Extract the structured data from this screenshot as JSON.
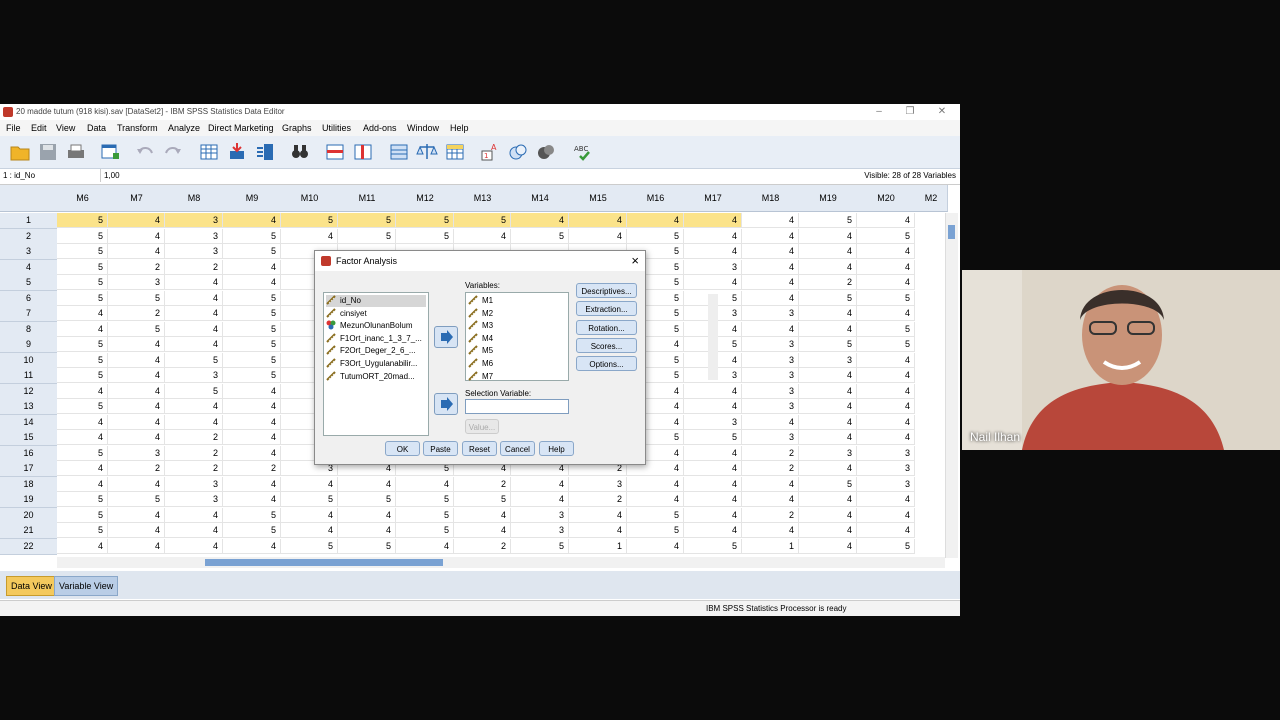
{
  "window": {
    "title": "20 madde tutum (918 kisi).sav [DataSet2] - IBM SPSS Statistics Data Editor"
  },
  "menu": [
    "File",
    "Edit",
    "View",
    "Data",
    "Transform",
    "Analyze",
    "Direct Marketing",
    "Graphs",
    "Utilities",
    "Add-ons",
    "Window",
    "Help"
  ],
  "toolbar": {
    "icons": [
      "open-icon",
      "save-icon",
      "print-icon",
      "dialog-recall-icon",
      "undo-icon",
      "redo-icon",
      "goto-case-icon",
      "goto-variable-icon",
      "variables-icon",
      "find-icon",
      "insert-cases-icon",
      "insert-variable-icon",
      "split-file-icon",
      "weight-cases-icon",
      "select-cases-icon",
      "value-labels-icon",
      "use-sets-icon",
      "show-sets-icon",
      "spell-check-icon"
    ]
  },
  "cellbar": {
    "ref": "1 : id_No",
    "value": "1,00",
    "visible": "Visible: 28 of 28 Variables"
  },
  "grid": {
    "columns": [
      "M6",
      "M7",
      "M8",
      "M9",
      "M10",
      "M11",
      "M12",
      "M13",
      "M14",
      "M15",
      "M16",
      "M17",
      "M18",
      "M19",
      "M20",
      "M2"
    ],
    "rows": [
      [
        "1",
        "5",
        "4",
        "3",
        "4",
        "5",
        "5",
        "5",
        "5",
        "4",
        "4",
        "4",
        "4",
        "4",
        "5",
        "4"
      ],
      [
        "2",
        "5",
        "4",
        "3",
        "5",
        "4",
        "5",
        "5",
        "4",
        "5",
        "4",
        "5",
        "4",
        "4",
        "4",
        "5"
      ],
      [
        "3",
        "5",
        "4",
        "3",
        "5",
        "",
        "",
        "",
        "",
        "",
        "",
        "5",
        "4",
        "4",
        "4",
        "4"
      ],
      [
        "4",
        "5",
        "2",
        "2",
        "4",
        "",
        "",
        "",
        "",
        "",
        "",
        "5",
        "3",
        "4",
        "4",
        "4"
      ],
      [
        "5",
        "5",
        "3",
        "4",
        "4",
        "",
        "",
        "",
        "",
        "",
        "",
        "5",
        "4",
        "4",
        "2",
        "4"
      ],
      [
        "6",
        "5",
        "5",
        "4",
        "5",
        "",
        "",
        "",
        "",
        "",
        "",
        "5",
        "5",
        "4",
        "5",
        "5"
      ],
      [
        "7",
        "4",
        "2",
        "4",
        "5",
        "",
        "",
        "",
        "",
        "",
        "",
        "5",
        "3",
        "3",
        "4",
        "4"
      ],
      [
        "8",
        "4",
        "5",
        "4",
        "5",
        "",
        "",
        "",
        "",
        "",
        "",
        "5",
        "4",
        "4",
        "4",
        "5"
      ],
      [
        "9",
        "5",
        "4",
        "4",
        "5",
        "",
        "",
        "",
        "",
        "",
        "",
        "4",
        "5",
        "3",
        "5",
        "5"
      ],
      [
        "10",
        "5",
        "4",
        "5",
        "5",
        "",
        "",
        "",
        "",
        "",
        "",
        "5",
        "4",
        "3",
        "3",
        "4"
      ],
      [
        "11",
        "5",
        "4",
        "3",
        "5",
        "",
        "",
        "",
        "",
        "",
        "",
        "5",
        "3",
        "3",
        "4",
        "4"
      ],
      [
        "12",
        "4",
        "4",
        "5",
        "4",
        "",
        "",
        "",
        "",
        "",
        "",
        "4",
        "4",
        "3",
        "4",
        "4"
      ],
      [
        "13",
        "5",
        "4",
        "4",
        "4",
        "",
        "",
        "",
        "",
        "",
        "",
        "4",
        "4",
        "3",
        "4",
        "4"
      ],
      [
        "14",
        "4",
        "4",
        "4",
        "4",
        "",
        "",
        "",
        "",
        "",
        "",
        "4",
        "3",
        "4",
        "4",
        "4"
      ],
      [
        "15",
        "4",
        "4",
        "2",
        "4",
        "",
        "",
        "",
        "",
        "",
        "",
        "5",
        "5",
        "3",
        "4",
        "4"
      ],
      [
        "16",
        "5",
        "3",
        "2",
        "4",
        "",
        "",
        "",
        "",
        "",
        "",
        "4",
        "4",
        "2",
        "3",
        "3"
      ],
      [
        "17",
        "4",
        "2",
        "2",
        "2",
        "3",
        "4",
        "5",
        "4",
        "4",
        "2",
        "4",
        "4",
        "2",
        "4",
        "3"
      ],
      [
        "18",
        "4",
        "4",
        "3",
        "4",
        "4",
        "4",
        "4",
        "2",
        "4",
        "3",
        "4",
        "4",
        "4",
        "5",
        "3"
      ],
      [
        "19",
        "5",
        "5",
        "3",
        "4",
        "5",
        "5",
        "5",
        "5",
        "4",
        "2",
        "4",
        "4",
        "4",
        "4",
        "4"
      ],
      [
        "20",
        "5",
        "4",
        "4",
        "5",
        "4",
        "4",
        "5",
        "4",
        "3",
        "4",
        "5",
        "4",
        "2",
        "4",
        "4"
      ],
      [
        "21",
        "5",
        "4",
        "4",
        "5",
        "4",
        "4",
        "5",
        "4",
        "3",
        "4",
        "5",
        "4",
        "4",
        "4",
        "4"
      ],
      [
        "22",
        "4",
        "4",
        "4",
        "4",
        "5",
        "5",
        "4",
        "2",
        "5",
        "1",
        "4",
        "5",
        "1",
        "4",
        "5"
      ]
    ]
  },
  "tabs": {
    "data_view": "Data View",
    "variable_view": "Variable View"
  },
  "status": "IBM SPSS Statistics Processor is ready",
  "dialog": {
    "title": "Factor Analysis",
    "source_vars": [
      "id_No",
      "cinsiyet",
      "MezunOlunanBolum",
      "F1Ort_inanc_1_3_7_...",
      "F2Ort_Deger_2_6_...",
      "F3Ort_Uygulanabilir...",
      "TutumORT_20mad..."
    ],
    "variables_label": "Variables:",
    "variables": [
      "M1",
      "M2",
      "M3",
      "M4",
      "M5",
      "M6",
      "M7"
    ],
    "selection_label": "Selection Variable:",
    "value_btn": "Value...",
    "side_buttons": [
      "Descriptives...",
      "Extraction...",
      "Rotation...",
      "Scores...",
      "Options..."
    ],
    "bottom_buttons": [
      "OK",
      "Paste",
      "Reset",
      "Cancel",
      "Help"
    ]
  },
  "video": {
    "name": "Nail Ilhan"
  }
}
